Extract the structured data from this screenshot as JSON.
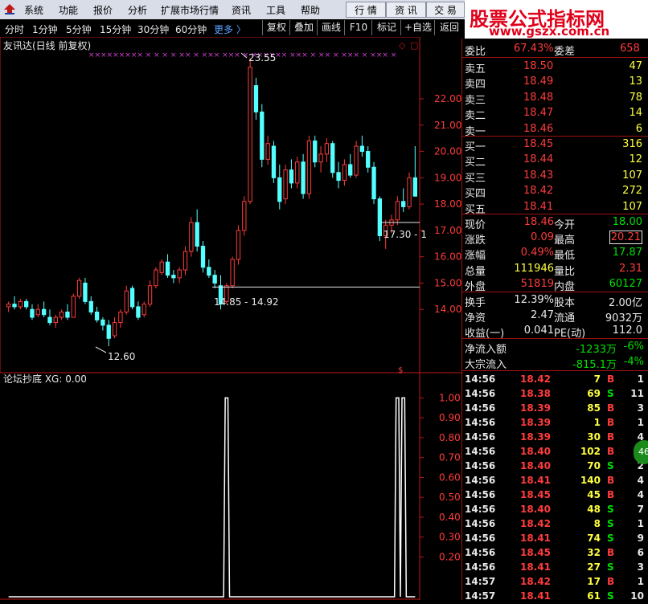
{
  "menu": {
    "items": [
      "系统",
      "功能",
      "报价",
      "分析",
      "扩展市场行情",
      "资讯",
      "工具",
      "帮助"
    ],
    "right_buttons": [
      "行 情",
      "资 讯",
      "交 易"
    ]
  },
  "brand": {
    "line1": "股票公式指标网",
    "line2": "www.gszx.com.cn"
  },
  "timeframes": [
    "分时",
    "1分钟",
    "5分钟",
    "15分钟",
    "30分钟",
    "60分钟"
  ],
  "more_label": "更多 〉",
  "tools": [
    "复权",
    "叠加",
    "画线",
    "F10",
    "标记",
    "+自选",
    "返回"
  ],
  "colors": {
    "up": "#ff3c3c",
    "down": "#54ffff",
    "indicator": "#ffffff",
    "axis": "#c01818"
  },
  "chart_data": [
    {
      "type": "candlestick",
      "title": "友讯达(日线 前复权)",
      "ylim": [
        13.0,
        23.8
      ],
      "yticks": [
        14.0,
        15.0,
        16.0,
        17.0,
        18.0,
        19.0,
        20.0,
        21.0,
        22.0
      ],
      "ytick_labels": [
        "14.00",
        "15.00",
        "16.00",
        "17.00",
        "18.00",
        "19.00",
        "20.00",
        "21.00",
        "22.00"
      ],
      "annotations": {
        "high": "23.55",
        "low": "12.60",
        "range1": "14.85 - 14.92",
        "range2": "17.30 - 1"
      },
      "levels": [
        14.85,
        17.3
      ],
      "marker_row": "×××××××××   ×   ×   ×   ×   ××  ×   ×××  ×××  ×  ××××××  ×××  ×   ××  ×   ×××  ×   ×××  ×",
      "ohlc": [
        [
          14.1,
          14.3,
          13.9,
          14.2
        ],
        [
          14.2,
          14.5,
          14.0,
          14.1
        ],
        [
          14.1,
          14.4,
          14.0,
          14.3
        ],
        [
          14.3,
          14.4,
          14.0,
          14.1
        ],
        [
          14.0,
          14.2,
          13.6,
          13.7
        ],
        [
          13.8,
          14.2,
          13.7,
          14.0
        ],
        [
          14.0,
          14.3,
          13.7,
          13.8
        ],
        [
          13.7,
          14.0,
          13.4,
          13.5
        ],
        [
          13.5,
          13.8,
          13.3,
          13.7
        ],
        [
          13.7,
          14.0,
          13.6,
          13.9
        ],
        [
          13.9,
          14.2,
          13.6,
          13.7
        ],
        [
          13.7,
          14.6,
          13.7,
          14.5
        ],
        [
          14.5,
          15.2,
          14.4,
          15.1
        ],
        [
          15.0,
          15.2,
          14.2,
          14.3
        ],
        [
          14.3,
          14.5,
          13.8,
          13.9
        ],
        [
          13.9,
          14.1,
          13.5,
          13.6
        ],
        [
          13.6,
          13.7,
          13.2,
          13.4
        ],
        [
          13.4,
          13.6,
          12.6,
          12.9
        ],
        [
          13.0,
          13.7,
          12.9,
          13.5
        ],
        [
          13.5,
          14.0,
          13.3,
          13.9
        ],
        [
          13.9,
          14.9,
          13.8,
          14.7
        ],
        [
          14.8,
          14.9,
          14.0,
          14.1
        ],
        [
          14.1,
          14.3,
          13.6,
          13.7
        ],
        [
          13.8,
          14.3,
          13.7,
          14.2
        ],
        [
          14.2,
          15.1,
          14.1,
          14.9
        ],
        [
          14.9,
          15.6,
          14.8,
          15.5
        ],
        [
          15.4,
          15.9,
          15.3,
          15.8
        ],
        [
          15.8,
          16.1,
          15.2,
          15.3
        ],
        [
          15.3,
          15.5,
          15.0,
          15.2
        ],
        [
          15.2,
          15.6,
          15.0,
          15.5
        ],
        [
          15.5,
          16.4,
          15.3,
          16.2
        ],
        [
          16.2,
          17.5,
          16.0,
          17.3
        ],
        [
          17.3,
          17.8,
          16.2,
          16.4
        ],
        [
          16.4,
          16.6,
          15.4,
          15.6
        ],
        [
          15.6,
          15.9,
          15.2,
          15.3
        ],
        [
          15.3,
          15.5,
          14.8,
          15.0
        ],
        [
          14.9,
          15.3,
          14.0,
          14.2
        ],
        [
          14.3,
          15.0,
          14.2,
          14.9
        ],
        [
          14.9,
          16.0,
          14.8,
          15.9
        ],
        [
          15.9,
          17.2,
          15.7,
          17.0
        ],
        [
          17.0,
          18.3,
          16.8,
          18.1
        ],
        [
          18.1,
          23.55,
          18.0,
          23.2
        ],
        [
          22.5,
          22.8,
          21.2,
          21.5
        ],
        [
          21.5,
          21.8,
          19.4,
          19.7
        ],
        [
          19.7,
          20.6,
          19.5,
          20.3
        ],
        [
          20.2,
          20.4,
          18.8,
          19.0
        ],
        [
          19.0,
          19.5,
          17.8,
          18.1
        ],
        [
          18.2,
          19.5,
          18.0,
          19.3
        ],
        [
          19.3,
          19.7,
          18.6,
          18.8
        ],
        [
          18.8,
          19.8,
          18.6,
          19.6
        ],
        [
          19.6,
          19.9,
          18.2,
          18.4
        ],
        [
          18.4,
          20.6,
          18.2,
          20.4
        ],
        [
          20.4,
          20.6,
          19.4,
          19.6
        ],
        [
          19.6,
          20.2,
          19.2,
          19.9
        ],
        [
          19.9,
          20.5,
          19.6,
          20.3
        ],
        [
          20.3,
          20.4,
          19.0,
          19.2
        ],
        [
          19.2,
          19.6,
          18.6,
          18.9
        ],
        [
          18.9,
          19.7,
          18.7,
          19.5
        ],
        [
          19.5,
          19.9,
          19.0,
          19.1
        ],
        [
          19.1,
          20.4,
          19.0,
          20.2
        ],
        [
          20.2,
          20.6,
          19.8,
          20.0
        ],
        [
          20.0,
          20.2,
          19.2,
          19.4
        ],
        [
          19.4,
          19.6,
          18.0,
          18.2
        ],
        [
          18.2,
          18.3,
          16.6,
          16.8
        ],
        [
          16.8,
          17.4,
          16.3,
          17.2
        ],
        [
          17.2,
          17.6,
          16.9,
          17.4
        ],
        [
          17.4,
          18.3,
          17.2,
          18.1
        ],
        [
          18.1,
          18.6,
          17.7,
          17.9
        ],
        [
          17.9,
          19.2,
          17.8,
          19.0
        ],
        [
          19.0,
          20.2,
          18.6,
          18.3
        ]
      ]
    },
    {
      "type": "line",
      "title": "论坛抄底 XG: 0.00",
      "ylim": [
        0,
        1.05
      ],
      "yticks": [
        0.2,
        0.3,
        0.4,
        0.5,
        0.6,
        0.7,
        0.8,
        0.9,
        1.0
      ],
      "ytick_labels": [
        "0.20",
        "0.30",
        "0.40",
        "0.50",
        "0.60",
        "0.70",
        "0.80",
        "0.90",
        "1.00"
      ],
      "pulses": [
        {
          "from": 37,
          "to": 37
        },
        {
          "from": 66,
          "to": 67
        }
      ]
    }
  ],
  "quote": {
    "wb_label": "委比",
    "wb_value": "67.43%",
    "wc_label": "委差",
    "wc_value": "658",
    "sells": [
      {
        "label": "卖五",
        "price": "18.50",
        "vol": "47"
      },
      {
        "label": "卖四",
        "price": "18.49",
        "vol": "13"
      },
      {
        "label": "卖三",
        "price": "18.48",
        "vol": "78"
      },
      {
        "label": "卖二",
        "price": "18.47",
        "vol": "14"
      },
      {
        "label": "卖一",
        "price": "18.46",
        "vol": "6"
      }
    ],
    "buys": [
      {
        "label": "买一",
        "price": "18.45",
        "vol": "316"
      },
      {
        "label": "买二",
        "price": "18.44",
        "vol": "12"
      },
      {
        "label": "买三",
        "price": "18.43",
        "vol": "107"
      },
      {
        "label": "买四",
        "price": "18.42",
        "vol": "272"
      },
      {
        "label": "买五",
        "price": "18.41",
        "vol": "107"
      }
    ],
    "stats": [
      {
        "l1": "现价",
        "v1": "18.46",
        "c1": "red",
        "l2": "今开",
        "v2": "18.00",
        "c2": "grn"
      },
      {
        "l1": "涨跌",
        "v1": "0.09",
        "c1": "red",
        "l2": "最高",
        "v2": "20.21",
        "c2": "red",
        "box2": true
      },
      {
        "l1": "涨幅",
        "v1": "0.49%",
        "c1": "red",
        "l2": "最低",
        "v2": "17.87",
        "c2": "grn"
      },
      {
        "l1": "总量",
        "v1": "111946",
        "c1": "yel",
        "l2": "量比",
        "v2": "2.31",
        "c2": "red"
      },
      {
        "l1": "外盘",
        "v1": "51819",
        "c1": "red",
        "l2": "内盘",
        "v2": "60127",
        "c2": "grn"
      }
    ],
    "fund": [
      {
        "l1": "换手",
        "v1": "12.39%",
        "l2": "股本",
        "v2": "2.00亿"
      },
      {
        "l1": "净资",
        "v1": "2.47",
        "l2": "流通",
        "v2": "9032万"
      },
      {
        "l1": "收益(一)",
        "v1": "0.041",
        "l2": "PE(动)",
        "v2": "112.0"
      }
    ],
    "flows": [
      {
        "label": "净流入额",
        "value": "-1233万",
        "pct": "-6%"
      },
      {
        "label": "大宗流入",
        "value": "-815.1万",
        "pct": "-4%"
      }
    ],
    "trades": [
      {
        "t": "14:56",
        "p": "18.42",
        "v": "7",
        "d": "B",
        "n": "1",
        "pc": "red"
      },
      {
        "t": "14:56",
        "p": "18.38",
        "v": "69",
        "d": "S",
        "n": "11",
        "pc": "red"
      },
      {
        "t": "14:56",
        "p": "18.39",
        "v": "85",
        "d": "B",
        "n": "3",
        "pc": "red"
      },
      {
        "t": "14:56",
        "p": "18.39",
        "v": "1",
        "d": "B",
        "n": "1",
        "pc": "red"
      },
      {
        "t": "14:56",
        "p": "18.39",
        "v": "30",
        "d": "B",
        "n": "4",
        "pc": "red"
      },
      {
        "t": "14:56",
        "p": "18.40",
        "v": "102",
        "d": "B",
        "n": "4",
        "pc": "red"
      },
      {
        "t": "14:56",
        "p": "18.40",
        "v": "70",
        "d": "S",
        "n": "2",
        "pc": "red"
      },
      {
        "t": "14:56",
        "p": "18.41",
        "v": "140",
        "d": "B",
        "n": "4",
        "pc": "red"
      },
      {
        "t": "14:56",
        "p": "18.45",
        "v": "45",
        "d": "B",
        "n": "4",
        "pc": "red"
      },
      {
        "t": "14:56",
        "p": "18.40",
        "v": "48",
        "d": "S",
        "n": "7",
        "pc": "red"
      },
      {
        "t": "14:56",
        "p": "18.42",
        "v": "8",
        "d": "S",
        "n": "1",
        "pc": "red"
      },
      {
        "t": "14:56",
        "p": "18.41",
        "v": "74",
        "d": "S",
        "n": "9",
        "pc": "red"
      },
      {
        "t": "14:56",
        "p": "18.45",
        "v": "32",
        "d": "B",
        "n": "6",
        "pc": "red"
      },
      {
        "t": "14:56",
        "p": "18.41",
        "v": "27",
        "d": "S",
        "n": "3",
        "pc": "red"
      },
      {
        "t": "14:57",
        "p": "18.42",
        "v": "17",
        "d": "B",
        "n": "1",
        "pc": "red"
      },
      {
        "t": "14:57",
        "p": "18.41",
        "v": "61",
        "d": "S",
        "n": "10",
        "pc": "red"
      }
    ],
    "badge": "46"
  }
}
